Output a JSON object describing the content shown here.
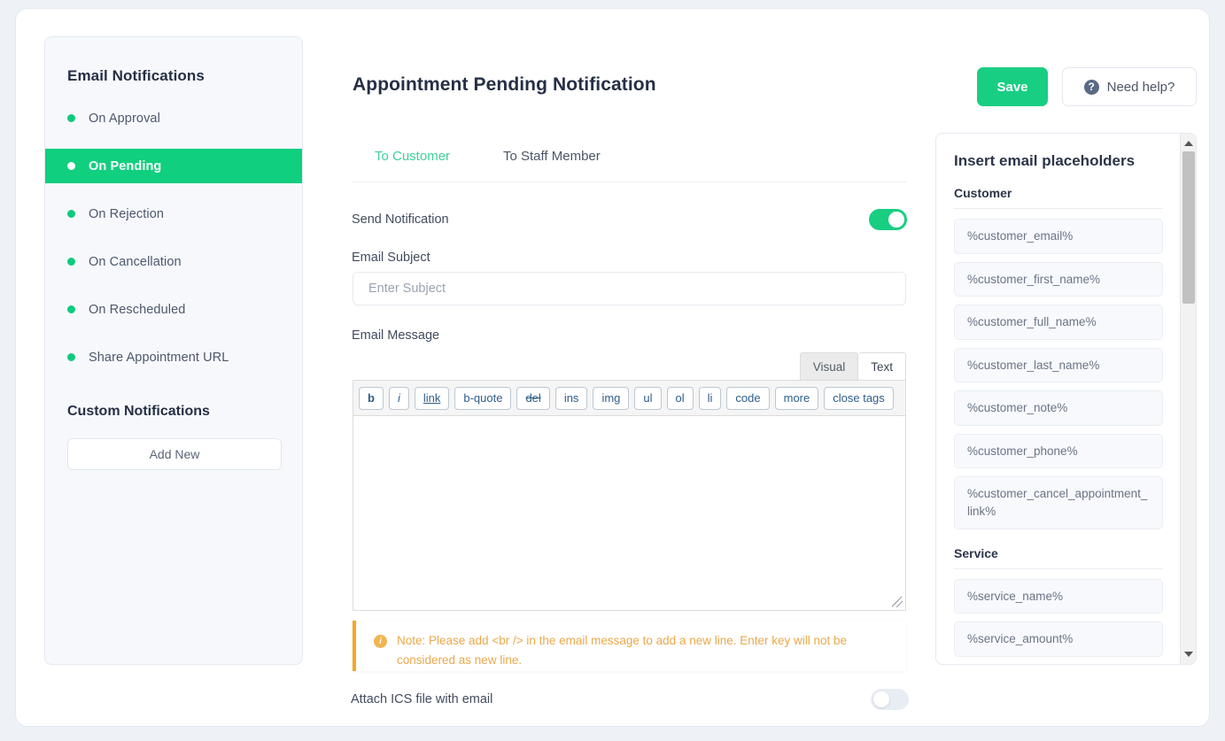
{
  "sidebar": {
    "title": "Email Notifications",
    "items": [
      {
        "label": "On Approval",
        "active": false
      },
      {
        "label": "On Pending",
        "active": true
      },
      {
        "label": "On Rejection",
        "active": false
      },
      {
        "label": "On Cancellation",
        "active": false
      },
      {
        "label": "On Rescheduled",
        "active": false
      },
      {
        "label": "Share Appointment URL",
        "active": false
      }
    ],
    "custom_title": "Custom Notifications",
    "add_new_label": "Add New"
  },
  "header": {
    "title": "Appointment Pending Notification",
    "save_label": "Save",
    "help_label": "Need help?",
    "help_icon": "question-circle-icon",
    "save_color": "#18ce82"
  },
  "tabs": [
    {
      "label": "To Customer",
      "active": true
    },
    {
      "label": "To Staff Member",
      "active": false
    }
  ],
  "form": {
    "send_notification_label": "Send Notification",
    "send_notification_on": true,
    "subject_label": "Email Subject",
    "subject_value": "",
    "subject_placeholder": "Enter Subject",
    "message_label": "Email Message",
    "message_value": "",
    "attach_ics_label": "Attach ICS file with email",
    "attach_ics_on": false
  },
  "editor": {
    "mode_tabs": [
      {
        "label": "Visual",
        "active": false
      },
      {
        "label": "Text",
        "active": true
      }
    ],
    "toolbar": [
      {
        "label": "b",
        "style": "bold"
      },
      {
        "label": "i",
        "style": "italic"
      },
      {
        "label": "link",
        "style": "under"
      },
      {
        "label": "b-quote",
        "style": ""
      },
      {
        "label": "del",
        "style": "strike"
      },
      {
        "label": "ins",
        "style": ""
      },
      {
        "label": "img",
        "style": ""
      },
      {
        "label": "ul",
        "style": ""
      },
      {
        "label": "ol",
        "style": ""
      },
      {
        "label": "li",
        "style": ""
      },
      {
        "label": "code",
        "style": ""
      },
      {
        "label": "more",
        "style": ""
      },
      {
        "label": "close tags",
        "style": ""
      }
    ]
  },
  "note": {
    "icon": "info-circle-icon",
    "text": "Note: Please add <br /> in the email message to add a new line. Enter key will not be considered as new line.",
    "accent_color": "#f5a623"
  },
  "placeholders": {
    "title": "Insert email placeholders",
    "groups": [
      {
        "name": "Customer",
        "items": [
          "%customer_email%",
          "%customer_first_name%",
          "%customer_full_name%",
          "%customer_last_name%",
          "%customer_note%",
          "%customer_phone%",
          "%customer_cancel_appointment_link%"
        ]
      },
      {
        "name": "Service",
        "items": [
          "%service_name%",
          "%service_amount%"
        ]
      }
    ],
    "scroll_up_icon": "chevron-up-icon",
    "scroll_down_icon": "chevron-down-icon"
  }
}
